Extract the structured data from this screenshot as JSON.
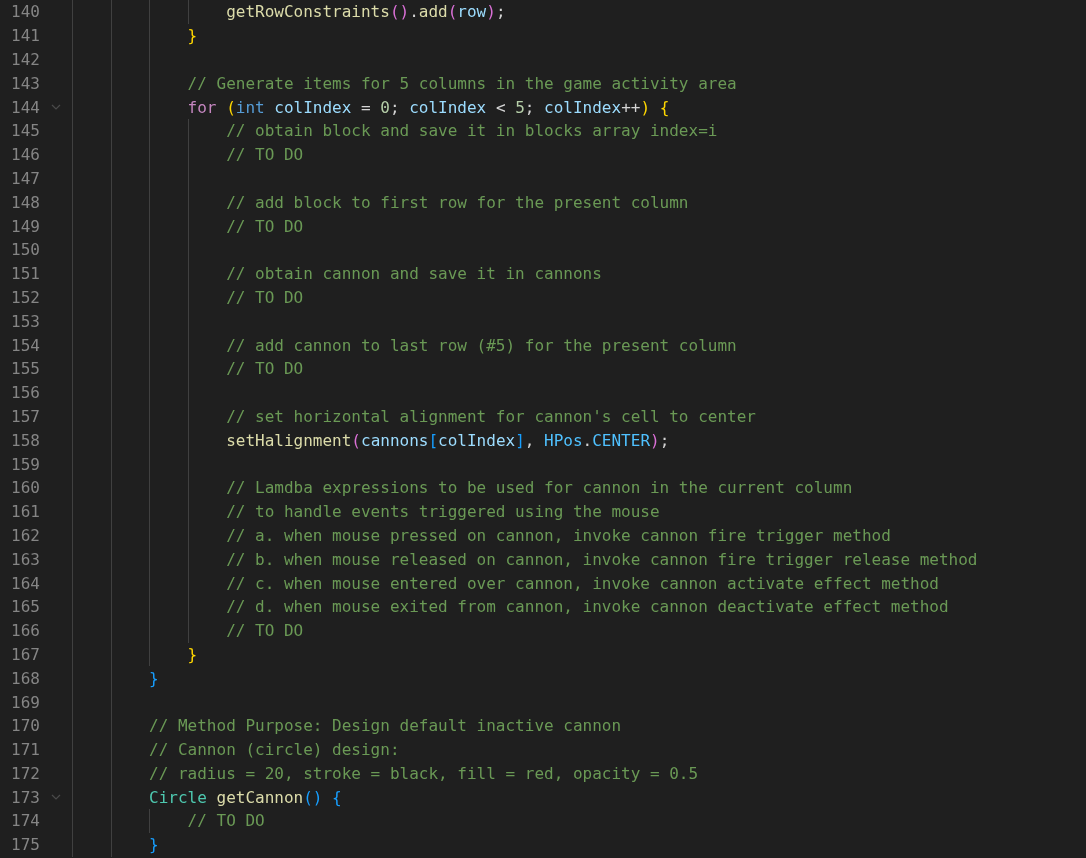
{
  "editor": {
    "lines": [
      {
        "number": "140",
        "foldable": false,
        "tokens": [
          {
            "text": "                getRowConstraints",
            "kind": "f"
          },
          {
            "text": "()",
            "kind": "b2"
          },
          {
            "text": ".",
            "kind": "p"
          },
          {
            "text": "add",
            "kind": "f"
          },
          {
            "text": "(",
            "kind": "b2"
          },
          {
            "text": "row",
            "kind": "v"
          },
          {
            "text": ")",
            "kind": "b2"
          },
          {
            "text": ";",
            "kind": "p"
          }
        ]
      },
      {
        "number": "141",
        "foldable": false,
        "tokens": [
          {
            "text": "            }",
            "kind": "b1"
          }
        ]
      },
      {
        "number": "142",
        "foldable": false
      },
      {
        "number": "143",
        "foldable": false,
        "tokens": [
          {
            "text": "            // Generate items for 5 columns in the game activity area",
            "kind": "c"
          }
        ]
      },
      {
        "number": "144",
        "foldable": true,
        "tokens": [
          {
            "text": "            for",
            "kind": "kw"
          },
          {
            "text": " (",
            "kind": "b1"
          },
          {
            "text": "int",
            "kind": "ty"
          },
          {
            "text": " colIndex",
            "kind": "v"
          },
          {
            "text": " = ",
            "kind": "p"
          },
          {
            "text": "0",
            "kind": "n"
          },
          {
            "text": "; ",
            "kind": "p"
          },
          {
            "text": "colIndex",
            "kind": "v"
          },
          {
            "text": " < ",
            "kind": "p"
          },
          {
            "text": "5",
            "kind": "n"
          },
          {
            "text": "; ",
            "kind": "p"
          },
          {
            "text": "colIndex",
            "kind": "v"
          },
          {
            "text": "++",
            "kind": "p"
          },
          {
            "text": ")",
            "kind": "b1"
          },
          {
            "text": " {",
            "kind": "b1"
          }
        ]
      },
      {
        "number": "145",
        "foldable": false,
        "tokens": [
          {
            "text": "                // obtain block and save it in blocks array index=i",
            "kind": "c"
          }
        ]
      },
      {
        "number": "146",
        "foldable": false,
        "tokens": [
          {
            "text": "                // TO DO",
            "kind": "c"
          }
        ]
      },
      {
        "number": "147",
        "foldable": false
      },
      {
        "number": "148",
        "foldable": false,
        "tokens": [
          {
            "text": "                // add block to first row for the present column",
            "kind": "c"
          }
        ]
      },
      {
        "number": "149",
        "foldable": false,
        "tokens": [
          {
            "text": "                // TO DO",
            "kind": "c"
          }
        ]
      },
      {
        "number": "150",
        "foldable": false
      },
      {
        "number": "151",
        "foldable": false,
        "tokens": [
          {
            "text": "                // obtain cannon and save it in cannons",
            "kind": "c"
          }
        ]
      },
      {
        "number": "152",
        "foldable": false,
        "tokens": [
          {
            "text": "                // TO DO",
            "kind": "c"
          }
        ]
      },
      {
        "number": "153",
        "foldable": false
      },
      {
        "number": "154",
        "foldable": false,
        "tokens": [
          {
            "text": "                // add cannon to last row (#5) for the present column",
            "kind": "c"
          }
        ]
      },
      {
        "number": "155",
        "foldable": false,
        "tokens": [
          {
            "text": "                // TO DO",
            "kind": "c"
          }
        ]
      },
      {
        "number": "156",
        "foldable": false
      },
      {
        "number": "157",
        "foldable": false,
        "tokens": [
          {
            "text": "                // set horizontal alignment for cannon's cell to center",
            "kind": "c"
          }
        ]
      },
      {
        "number": "158",
        "foldable": false,
        "tokens": [
          {
            "text": "                setHalignment",
            "kind": "f"
          },
          {
            "text": "(",
            "kind": "b2"
          },
          {
            "text": "cannons",
            "kind": "v"
          },
          {
            "text": "[",
            "kind": "b3"
          },
          {
            "text": "colIndex",
            "kind": "v"
          },
          {
            "text": "]",
            "kind": "b3"
          },
          {
            "text": ", ",
            "kind": "p"
          },
          {
            "text": "HPos",
            "kind": "k"
          },
          {
            "text": ".",
            "kind": "p"
          },
          {
            "text": "CENTER",
            "kind": "k"
          },
          {
            "text": ")",
            "kind": "b2"
          },
          {
            "text": ";",
            "kind": "p"
          }
        ]
      },
      {
        "number": "159",
        "foldable": false
      },
      {
        "number": "160",
        "foldable": false,
        "tokens": [
          {
            "text": "                // Lamdba expressions to be used for cannon in the current column",
            "kind": "c"
          }
        ]
      },
      {
        "number": "161",
        "foldable": false,
        "tokens": [
          {
            "text": "                // to handle events triggered using the mouse",
            "kind": "c"
          }
        ]
      },
      {
        "number": "162",
        "foldable": false,
        "tokens": [
          {
            "text": "                // a. when mouse pressed on cannon, invoke cannon fire trigger method",
            "kind": "c"
          }
        ]
      },
      {
        "number": "163",
        "foldable": false,
        "tokens": [
          {
            "text": "                // b. when mouse released on cannon, invoke cannon fire trigger release method",
            "kind": "c"
          }
        ]
      },
      {
        "number": "164",
        "foldable": false,
        "tokens": [
          {
            "text": "                // c. when mouse entered over cannon, invoke cannon activate effect method",
            "kind": "c"
          }
        ]
      },
      {
        "number": "165",
        "foldable": false,
        "tokens": [
          {
            "text": "                // d. when mouse exited from cannon, invoke cannon deactivate effect method",
            "kind": "c"
          }
        ]
      },
      {
        "number": "166",
        "foldable": false,
        "tokens": [
          {
            "text": "                // TO DO",
            "kind": "c"
          }
        ]
      },
      {
        "number": "167",
        "foldable": false,
        "tokens": [
          {
            "text": "            }",
            "kind": "b1"
          }
        ]
      },
      {
        "number": "168",
        "foldable": false,
        "tokens": [
          {
            "text": "        }",
            "kind": "b3"
          }
        ]
      },
      {
        "number": "169",
        "foldable": false
      },
      {
        "number": "170",
        "foldable": false,
        "tokens": [
          {
            "text": "        // Method Purpose: Design default inactive cannon",
            "kind": "c"
          }
        ]
      },
      {
        "number": "171",
        "foldable": false,
        "tokens": [
          {
            "text": "        // Cannon (circle) design:",
            "kind": "c"
          }
        ]
      },
      {
        "number": "172",
        "foldable": false,
        "tokens": [
          {
            "text": "        // radius = 20, stroke = black, fill = red, opacity = 0.5",
            "kind": "c"
          }
        ]
      },
      {
        "number": "173",
        "foldable": true,
        "tokens": [
          {
            "text": "        Circle",
            "kind": "cl"
          },
          {
            "text": " getCannon",
            "kind": "f"
          },
          {
            "text": "()",
            "kind": "b3"
          },
          {
            "text": " {",
            "kind": "b3"
          }
        ]
      },
      {
        "number": "174",
        "foldable": false,
        "tokens": [
          {
            "text": "            // TO DO",
            "kind": "c"
          }
        ]
      },
      {
        "number": "175",
        "foldable": false,
        "tokens": [
          {
            "text": "        }",
            "kind": "b3"
          }
        ]
      }
    ]
  }
}
